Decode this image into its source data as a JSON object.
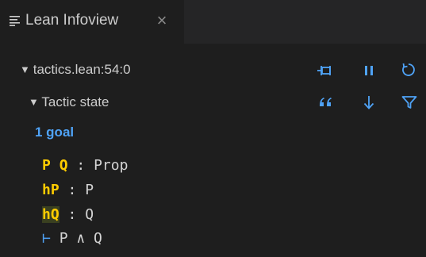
{
  "tab": {
    "title": "Lean Infoview",
    "close_glyph": "×",
    "icon": "list-lines-icon"
  },
  "location": {
    "caret": "▼",
    "label": "tactics.lean:54:0"
  },
  "tactic_state": {
    "caret": "▼",
    "label": "Tactic state"
  },
  "goal_count": "1 goal",
  "hypotheses": [
    {
      "names": [
        "P",
        "Q"
      ],
      "colon": ":",
      "type": "Prop"
    },
    {
      "names": [
        "hP"
      ],
      "colon": ":",
      "type": "P"
    },
    {
      "names": [
        "hQ"
      ],
      "colon": ":",
      "type": "Q"
    }
  ],
  "goal": {
    "turnstile": "⊢",
    "type": "P ∧ Q"
  },
  "toolbar": {
    "icons": [
      "pin-icon",
      "pause-icon",
      "refresh-icon",
      "quote-icon",
      "arrow-down-icon",
      "filter-icon"
    ]
  },
  "colors": {
    "background": "#1e1e1e",
    "tabbar": "#252526",
    "accent_blue": "#4fa3f7",
    "hyp_name_yellow": "#ffcc00",
    "text": "#cccccc"
  }
}
